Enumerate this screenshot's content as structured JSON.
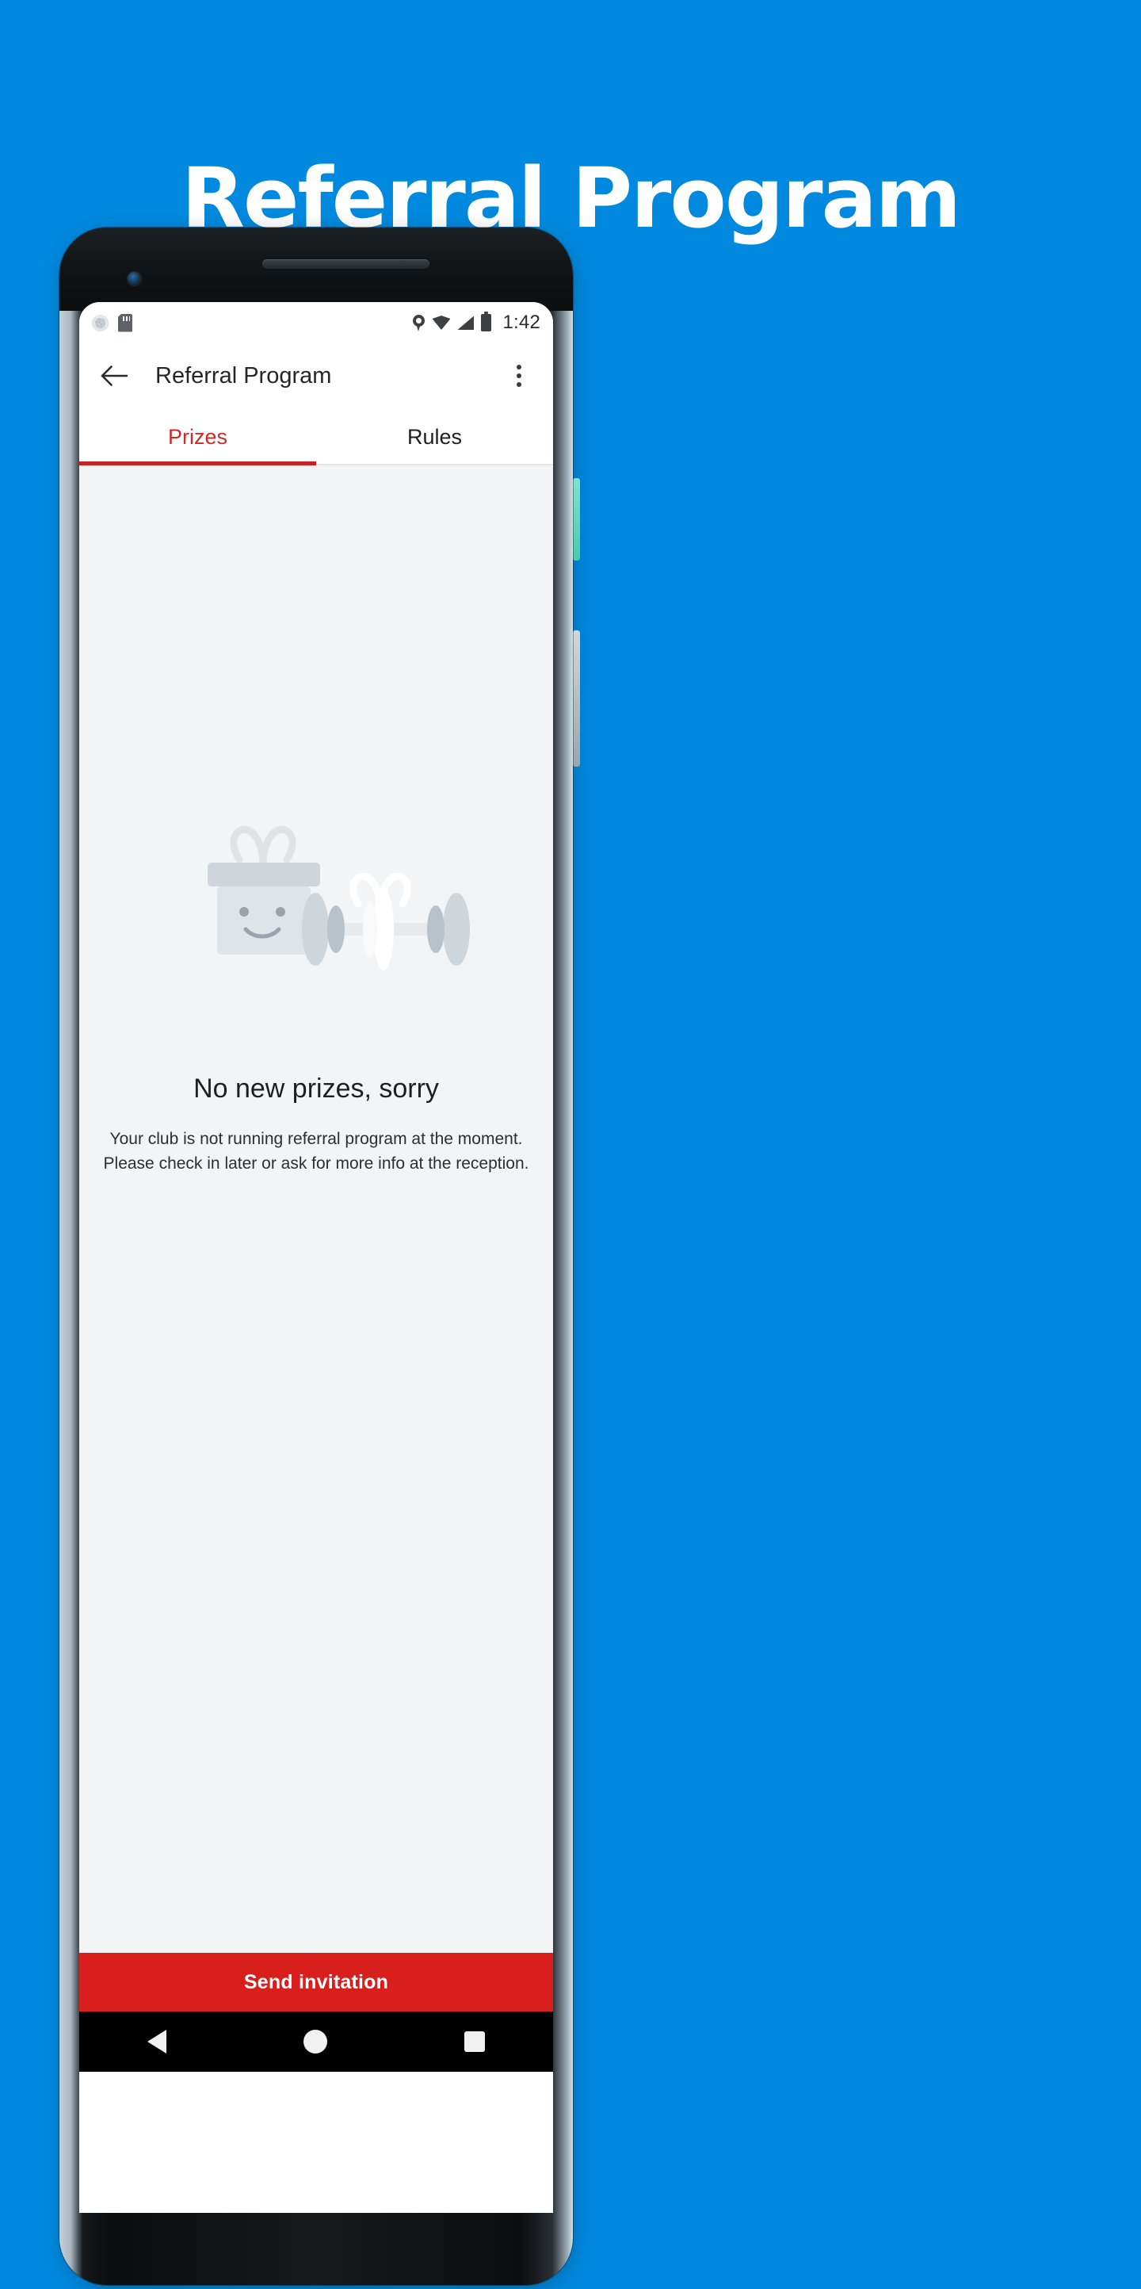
{
  "promo": {
    "title": "Referral Program",
    "background_color": "#0089DE",
    "title_color": "#FFFFFF"
  },
  "phone": {
    "status_bar": {
      "time": "1:42",
      "left_icons": [
        "sync-icon",
        "sd-card-icon"
      ],
      "right_icons": [
        "location-icon",
        "wifi-icon",
        "cellular-signal-icon",
        "battery-icon"
      ]
    },
    "toolbar": {
      "back_icon": "back-arrow-icon",
      "title": "Referral Program",
      "overflow_icon": "overflow-menu-icon"
    },
    "tabs": {
      "items": [
        {
          "label": "Prizes",
          "active": true
        },
        {
          "label": "Rules",
          "active": false
        }
      ],
      "active_color": "#CC2121",
      "inactive_color": "#1F1F1F"
    },
    "empty_state": {
      "illustration": "gift-and-dumbbell-illustration",
      "title": "No new prizes, sorry",
      "body_line1": "Your club is not running referral program at the moment.",
      "body_line2": "Please check in later or ask for more info at the reception."
    },
    "cta": {
      "label": "Send invitation",
      "background_color": "#D81F1C",
      "text_color": "#FFFFFF"
    },
    "nav_bar": {
      "back": "nav-back-triangle-icon",
      "home": "nav-home-circle-icon",
      "recents": "nav-recents-square-icon"
    },
    "content_background": "#F2F4F6"
  }
}
